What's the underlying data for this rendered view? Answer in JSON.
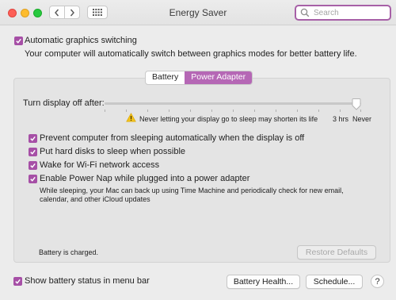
{
  "window": {
    "title": "Energy Saver"
  },
  "search": {
    "placeholder": "Search"
  },
  "auto_graphics": {
    "label": "Automatic graphics switching",
    "checked": true,
    "description": "Your computer will automatically switch between graphics modes for better battery life."
  },
  "tabs": [
    {
      "label": "Battery",
      "selected": false
    },
    {
      "label": "Power Adapter",
      "selected": true
    }
  ],
  "display_sleep": {
    "label": "Turn display off after:",
    "value": "Never",
    "warning": "Never letting your display go to sleep may shorten its life",
    "tick_labels": [
      "3 hrs",
      "Never"
    ]
  },
  "options": [
    {
      "label": "Prevent computer from sleeping automatically when the display is off",
      "checked": true
    },
    {
      "label": "Put hard disks to sleep when possible",
      "checked": true
    },
    {
      "label": "Wake for Wi-Fi network access",
      "checked": true
    },
    {
      "label": "Enable Power Nap while plugged into a power adapter",
      "checked": true,
      "description_line1": "While sleeping, your Mac can back up using Time Machine and periodically check for new email,",
      "description_line2": "calendar, and other iCloud updates"
    }
  ],
  "status": {
    "text": "Battery is charged."
  },
  "buttons": {
    "restore_defaults": "Restore Defaults",
    "battery_health": "Battery Health...",
    "schedule": "Schedule...",
    "help": "?"
  },
  "footer": {
    "show_battery_status": "Show battery status in menu bar",
    "checked": true
  },
  "colors": {
    "accent": "#a64fa6",
    "tab_active": "#b567b5",
    "search_ring": "#a760a7",
    "warning": "#f3c21b"
  },
  "icons": [
    "back-chevron-icon",
    "forward-chevron-icon",
    "grid-icon",
    "search-icon",
    "checkmark-icon",
    "warning-icon"
  ]
}
